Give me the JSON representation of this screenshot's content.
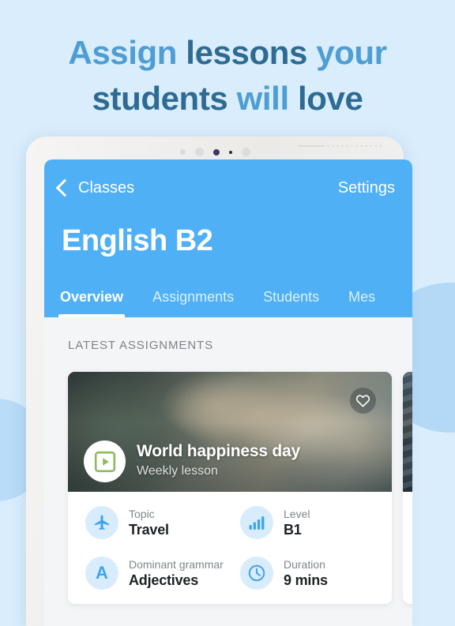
{
  "headline": {
    "line1_part1": "Assign ",
    "line1_part2": "lessons ",
    "line1_part3": "your",
    "line2_part1": "students ",
    "line2_part2": "will ",
    "line2_part3": "love"
  },
  "colors": {
    "page_background": "#d9edfd",
    "headline_light": "#4e9ed3",
    "headline_dark": "#2e6b93",
    "header_blue": "#4fb0f5",
    "icon_blue": "#3fa3f0",
    "icon_circle_bg": "#d9ecfb",
    "play_icon_green": "#8cbb5c",
    "content_background": "#f4f5f7"
  },
  "app": {
    "nav": {
      "back_label": "Classes",
      "back_icon": "chevron-left-icon",
      "settings_label": "Settings"
    },
    "class_title": "English B2",
    "tabs": [
      {
        "label": "Overview",
        "active": true
      },
      {
        "label": "Assignments",
        "active": false
      },
      {
        "label": "Students",
        "active": false
      },
      {
        "label": "Mes",
        "active": false
      }
    ],
    "section_title": "LATEST ASSIGNMENTS",
    "cards": [
      {
        "title": "World happiness day",
        "subtitle": "Weekly lesson",
        "favorite_icon": "heart-icon",
        "lesson_type_icon": "video-play-icon",
        "meta": [
          {
            "icon": "airplane-icon",
            "label": "Topic",
            "value": "Travel"
          },
          {
            "icon": "bar-chart-icon",
            "label": "Level",
            "value": "B1"
          },
          {
            "icon": "letter-a-icon",
            "label": "Dominant grammar",
            "value": "Adjectives"
          },
          {
            "icon": "clock-icon",
            "label": "Duration",
            "value": "9 mins"
          }
        ]
      }
    ]
  }
}
